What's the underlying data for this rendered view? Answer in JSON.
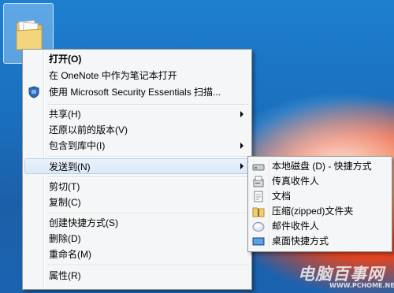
{
  "menu": {
    "items": [
      {
        "label": "打开(O)",
        "bold": true
      },
      {
        "label": "在 OneNote 中作为笔记本打开"
      },
      {
        "label": "使用 Microsoft Security Essentials 扫描...",
        "icon": "security-essentials-icon"
      },
      {
        "label": "共享(H)",
        "submenu": true
      },
      {
        "label": "还原以前的版本(V)"
      },
      {
        "label": "包含到库中(I)",
        "submenu": true
      },
      {
        "label": "发送到(N)",
        "submenu": true,
        "highlighted": true
      },
      {
        "label": "剪切(T)"
      },
      {
        "label": "复制(C)"
      },
      {
        "label": "创建快捷方式(S)"
      },
      {
        "label": "删除(D)"
      },
      {
        "label": "重命名(M)"
      },
      {
        "label": "属性(R)"
      }
    ]
  },
  "submenu": {
    "items": [
      {
        "label": "本地磁盘 (D) - 快捷方式",
        "icon": "drive-icon"
      },
      {
        "label": "传真收件人",
        "icon": "fax-icon"
      },
      {
        "label": "文档",
        "icon": "documents-icon"
      },
      {
        "label": "压缩(zipped)文件夹",
        "icon": "zip-folder-icon"
      },
      {
        "label": "邮件收件人",
        "icon": "mail-icon"
      },
      {
        "label": "桌面快捷方式",
        "icon": "desktop-icon"
      }
    ]
  },
  "watermark": {
    "text": "电脑百事网",
    "sub": "WWW.PCHOME.NET"
  }
}
